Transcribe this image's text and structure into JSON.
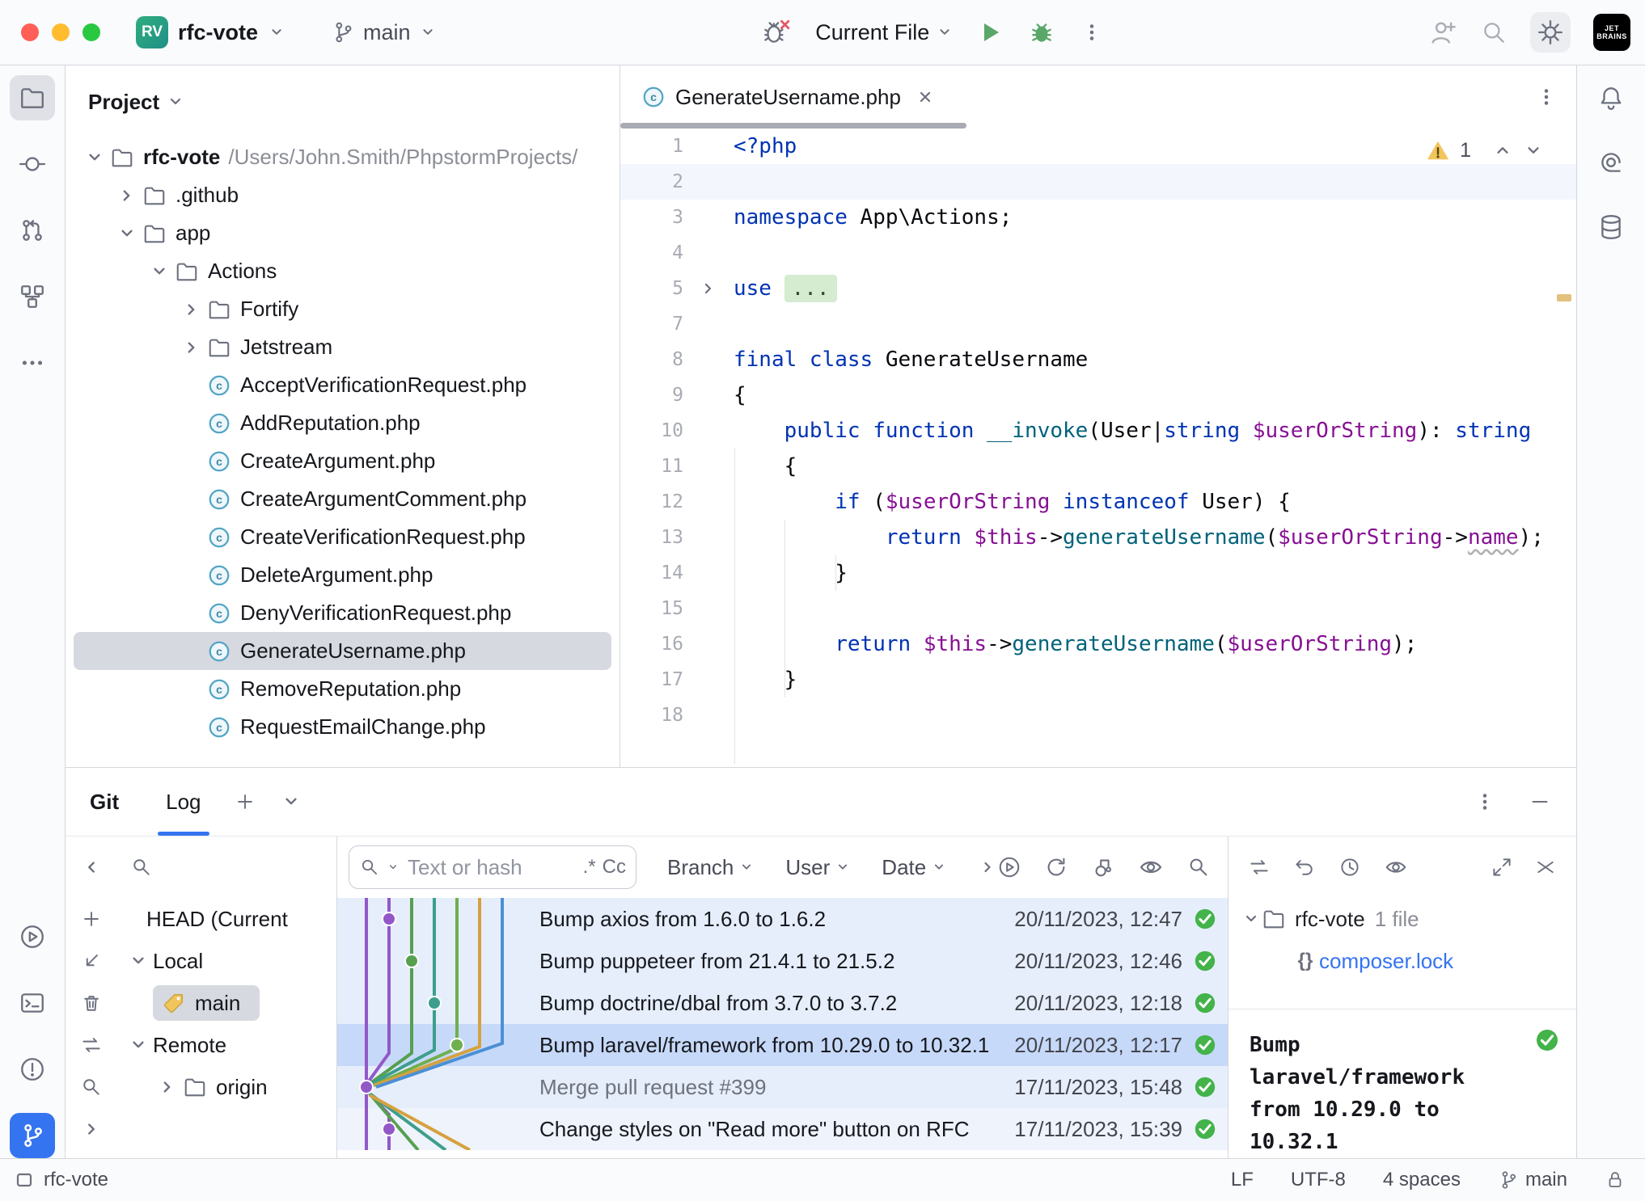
{
  "titlebar": {
    "project_badge": "RV",
    "project_name": "rfc-vote",
    "branch": "main",
    "run_config": "Current File",
    "logo": {
      "line1": "JET",
      "line2": "BRAINS"
    }
  },
  "project_panel": {
    "title": "Project",
    "tree": [
      {
        "label": "rfc-vote",
        "path": "/Users/John.Smith/PhpstormProjects/",
        "type": "folder",
        "chevron": "down",
        "indent": 0,
        "bold": true
      },
      {
        "label": ".github",
        "type": "folder",
        "chevron": "right",
        "indent": 1
      },
      {
        "label": "app",
        "type": "folder",
        "chevron": "down",
        "indent": 1
      },
      {
        "label": "Actions",
        "type": "folder",
        "chevron": "down",
        "indent": 2
      },
      {
        "label": "Fortify",
        "type": "folder",
        "chevron": "right",
        "indent": 3
      },
      {
        "label": "Jetstream",
        "type": "folder",
        "chevron": "right",
        "indent": 3
      },
      {
        "label": "AcceptVerificationRequest.php",
        "type": "php",
        "indent": 3
      },
      {
        "label": "AddReputation.php",
        "type": "php",
        "indent": 3
      },
      {
        "label": "CreateArgument.php",
        "type": "php",
        "indent": 3
      },
      {
        "label": "CreateArgumentComment.php",
        "type": "php",
        "indent": 3
      },
      {
        "label": "CreateVerificationRequest.php",
        "type": "php",
        "indent": 3
      },
      {
        "label": "DeleteArgument.php",
        "type": "php",
        "indent": 3
      },
      {
        "label": "DenyVerificationRequest.php",
        "type": "php",
        "indent": 3
      },
      {
        "label": "GenerateUsername.php",
        "type": "php",
        "indent": 3,
        "selected": true
      },
      {
        "label": "RemoveReputation.php",
        "type": "php",
        "indent": 3
      },
      {
        "label": "RequestEmailChange.php",
        "type": "php",
        "indent": 3
      }
    ]
  },
  "editor": {
    "tab_title": "GenerateUsername.php",
    "warning_count": "1",
    "code": [
      {
        "num": "1",
        "seg": [
          [
            "<?php",
            "k"
          ]
        ]
      },
      {
        "num": "2",
        "caret": true,
        "seg": []
      },
      {
        "num": "3",
        "seg": [
          [
            "namespace",
            "k"
          ],
          [
            " App\\Actions;",
            "p"
          ]
        ]
      },
      {
        "num": "4",
        "seg": []
      },
      {
        "num": "5",
        "fold": true,
        "seg": [
          [
            "use",
            "k"
          ],
          [
            " ",
            "p"
          ],
          [
            "...",
            "fo"
          ]
        ]
      },
      {
        "num": "7",
        "seg": []
      },
      {
        "num": "8",
        "seg": [
          [
            "final class",
            "k"
          ],
          [
            " GenerateUsername",
            "p"
          ]
        ]
      },
      {
        "num": "9",
        "seg": [
          [
            "{",
            "p"
          ]
        ]
      },
      {
        "num": "10",
        "seg": [
          [
            "    ",
            "p"
          ],
          [
            "public function",
            "k"
          ],
          [
            " ",
            "p"
          ],
          [
            "__invoke",
            "f"
          ],
          [
            "(User|",
            "p"
          ],
          [
            "string",
            "k"
          ],
          [
            " ",
            "p"
          ],
          [
            "$userOrString",
            "v"
          ],
          [
            "): ",
            "p"
          ],
          [
            "string",
            "k"
          ]
        ]
      },
      {
        "num": "11",
        "seg": [
          [
            "    {",
            "p"
          ]
        ]
      },
      {
        "num": "12",
        "seg": [
          [
            "        ",
            "p"
          ],
          [
            "if",
            "k"
          ],
          [
            " (",
            "p"
          ],
          [
            "$userOrString",
            "v"
          ],
          [
            " ",
            "p"
          ],
          [
            "instanceof",
            "k"
          ],
          [
            " User) {",
            "p"
          ]
        ]
      },
      {
        "num": "13",
        "seg": [
          [
            "            ",
            "p"
          ],
          [
            "return",
            "k"
          ],
          [
            " ",
            "p"
          ],
          [
            "$this",
            "v"
          ],
          [
            "->",
            "p"
          ],
          [
            "generateUsername",
            "f"
          ],
          [
            "(",
            "p"
          ],
          [
            "$userOrString",
            "v"
          ],
          [
            "->",
            "p"
          ],
          [
            "name",
            "fl"
          ],
          [
            ");",
            "p"
          ]
        ]
      },
      {
        "num": "14",
        "seg": [
          [
            "        }",
            "p"
          ]
        ]
      },
      {
        "num": "15",
        "seg": []
      },
      {
        "num": "16",
        "seg": [
          [
            "        ",
            "p"
          ],
          [
            "return",
            "k"
          ],
          [
            " ",
            "p"
          ],
          [
            "$this",
            "v"
          ],
          [
            "->",
            "p"
          ],
          [
            "generateUsername",
            "f"
          ],
          [
            "(",
            "p"
          ],
          [
            "$userOrString",
            "v"
          ],
          [
            ");",
            "p"
          ]
        ]
      },
      {
        "num": "17",
        "seg": [
          [
            "    }",
            "p"
          ]
        ]
      },
      {
        "num": "18",
        "seg": []
      }
    ]
  },
  "git": {
    "panel_title": "Git",
    "tab": "Log",
    "branches": {
      "rows": [
        {
          "label": "HEAD (Current",
          "type": "head"
        },
        {
          "label": "Local",
          "type": "group",
          "chevron": "down"
        },
        {
          "label": "main",
          "type": "branch",
          "icon": "tag",
          "selected": true
        },
        {
          "label": "Remote",
          "type": "group",
          "chevron": "down"
        },
        {
          "label": "origin",
          "type": "folder",
          "chevron": "right",
          "icon": "folder"
        }
      ]
    },
    "log": {
      "search_placeholder": "Text or hash",
      "regex_toggle": ".*",
      "case_toggle": "Cc",
      "filters": [
        "Branch",
        "User",
        "Date"
      ],
      "commits": [
        {
          "message": "Bump axios from 1.6.0 to 1.6.2",
          "date": "20/11/2023, 12:47",
          "hl": "light",
          "status": "success"
        },
        {
          "message": "Bump puppeteer from 21.4.1 to 21.5.2",
          "date": "20/11/2023, 12:46",
          "hl": "light",
          "status": "success"
        },
        {
          "message": "Bump doctrine/dbal from 3.7.0 to 3.7.2",
          "date": "20/11/2023, 12:18",
          "hl": "light",
          "status": "success"
        },
        {
          "message": "Bump laravel/framework from 10.29.0 to 10.32.1",
          "date": "20/11/2023, 12:17",
          "hl": "selected",
          "status": "success"
        },
        {
          "message": "Merge pull request #399",
          "date": "17/11/2023, 15:48",
          "hl": "light",
          "muted": true,
          "status": "success"
        },
        {
          "message": "Change styles on \"Read more\" button on RFC",
          "date": "17/11/2023, 15:39",
          "hl": "faint",
          "status": "success"
        }
      ]
    },
    "details": {
      "root": "rfc-vote",
      "root_meta": "1 file",
      "file": "composer.lock",
      "message": "Bump laravel/framework from 10.29.0 to 10.32.1"
    }
  },
  "status_bar": {
    "project": "rfc-vote",
    "line_ending": "LF",
    "encoding": "UTF-8",
    "indent": "4 spaces",
    "branch": "main"
  }
}
